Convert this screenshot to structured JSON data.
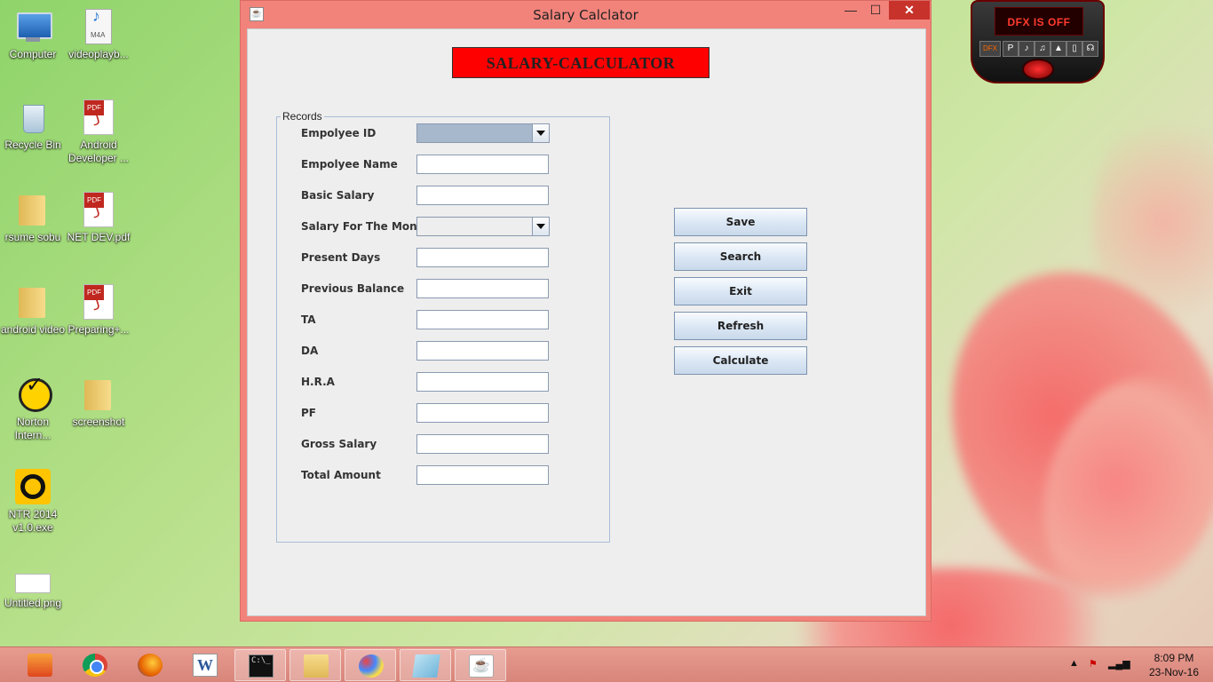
{
  "desktop": {
    "icons": [
      {
        "label": "Computer",
        "icon": "computer-icon"
      },
      {
        "label": "videoplayb...",
        "icon": "m4a-file-icon",
        "badge": "M4A"
      },
      {
        "label": "Recycle Bin",
        "icon": "recycle-bin-icon"
      },
      {
        "label": "Android Developer ...",
        "icon": "pdf-file-icon"
      },
      {
        "label": "rsume sobu",
        "icon": "folder-icon"
      },
      {
        "label": "NET DEV.pdf",
        "icon": "pdf-file-icon"
      },
      {
        "label": "android video",
        "icon": "folder-icon"
      },
      {
        "label": "Preparing+...",
        "icon": "pdf-file-icon"
      },
      {
        "label": "Norton Intern...",
        "icon": "norton-icon"
      },
      {
        "label": "screenshot",
        "icon": "folder-icon"
      },
      {
        "label": "NTR 2014 v1.0.exe",
        "icon": "ntr-icon"
      },
      {
        "label": "Untitled.png",
        "icon": "image-file-icon"
      }
    ]
  },
  "dfx": {
    "status": "DFX IS OFF",
    "buttons": [
      "DFX",
      "P",
      "♪",
      "♫",
      "▲",
      "▯",
      "☊"
    ]
  },
  "window": {
    "title": "Salary Calclator",
    "controls": {
      "minimize": "—",
      "maximize": "☐",
      "close": "✕"
    },
    "banner": "SALARY-CALCULATOR",
    "group_label": "Records",
    "fields": [
      {
        "label": "Empolyee ID",
        "type": "combo",
        "value": ""
      },
      {
        "label": "Empolyee Name",
        "type": "text",
        "value": ""
      },
      {
        "label": "Basic Salary",
        "type": "text",
        "value": ""
      },
      {
        "label": "Salary For The Month",
        "type": "combo",
        "value": ""
      },
      {
        "label": "Present Days",
        "type": "text",
        "value": ""
      },
      {
        "label": "Previous Balance",
        "type": "text",
        "value": ""
      },
      {
        "label": "TA",
        "type": "text",
        "value": ""
      },
      {
        "label": "DA",
        "type": "text",
        "value": ""
      },
      {
        "label": "H.R.A",
        "type": "text",
        "value": ""
      },
      {
        "label": "PF",
        "type": "text",
        "value": ""
      },
      {
        "label": "Gross Salary",
        "type": "text",
        "value": ""
      },
      {
        "label": "Total Amount",
        "type": "text",
        "value": ""
      }
    ],
    "buttons": {
      "save": "Save",
      "search": "Search",
      "exit": "Exit",
      "refresh": "Refresh",
      "calculate": "Calculate"
    },
    "colors": {
      "banner": "#ff0000",
      "titlebar": "#f2837b",
      "combo_active": "#a7b8cd"
    }
  },
  "taskbar": {
    "apps": [
      "start-icon",
      "chrome-icon",
      "firefox-icon",
      "word-icon",
      "cmd-icon",
      "file-explorer-icon",
      "paint-icon",
      "notes-icon",
      "java-icon"
    ],
    "cmd_text": "C:\\_",
    "word_letter": "W",
    "java_glyph": "☕",
    "tray": {
      "up_arrow": "▲",
      "flag": "⚑",
      "signal": "▂▄▆"
    },
    "time": "8:09 PM",
    "date": "23-Nov-16"
  }
}
